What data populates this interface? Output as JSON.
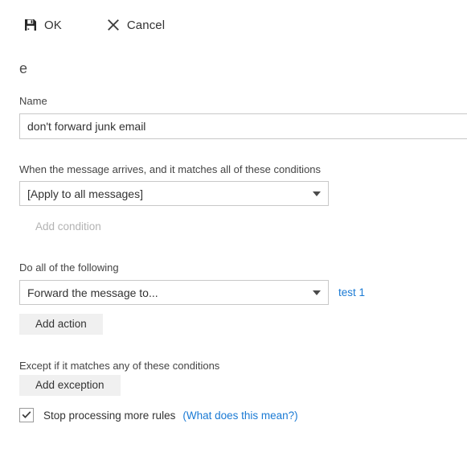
{
  "command_bar": {
    "ok_label": "OK",
    "ok_icon": "save-floppy-icon",
    "cancel_label": "Cancel",
    "cancel_icon": "close-x-icon"
  },
  "rule": {
    "title": "e"
  },
  "name_field": {
    "label": "Name",
    "value": "don't forward junk email",
    "placeholder": ""
  },
  "conditions": {
    "label": "When the message arrives, and it matches all of these conditions",
    "selected": "[Apply to all messages]",
    "add_label": "Add condition",
    "add_disabled": true
  },
  "actions": {
    "label": "Do all of the following",
    "selected": "Forward the message to...",
    "target_link": "test 1",
    "add_label": "Add action"
  },
  "exceptions": {
    "label": "Except if it matches any of these conditions",
    "add_label": "Add exception"
  },
  "stop_processing": {
    "label": "Stop processing more rules",
    "checked": true,
    "help_link": "(What does this mean?)"
  },
  "colors": {
    "link_blue": "#1a7ad4",
    "text": "#333333",
    "disabled_text": "#b3b3b3",
    "border": "#c8c8c8",
    "button_bg": "#f0f0f0"
  }
}
